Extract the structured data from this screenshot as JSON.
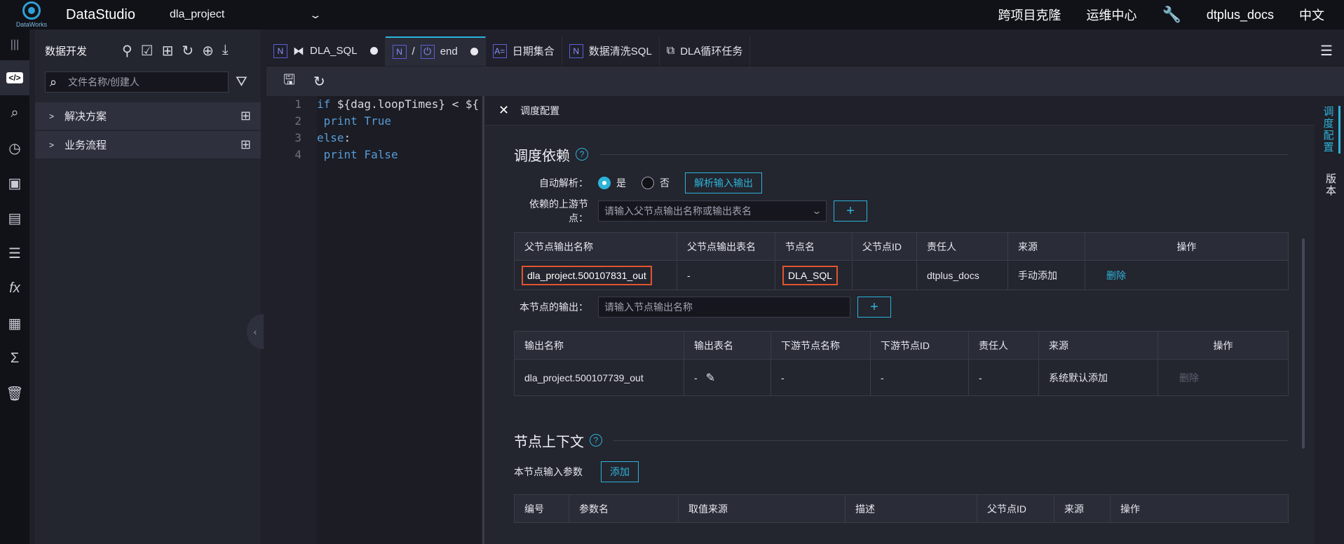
{
  "topbar": {
    "logo_text": "DataWorks",
    "app_title": "DataStudio",
    "project": "dla_project",
    "cross_clone": "跨项目克隆",
    "ops_center": "运维中心",
    "user": "dtplus_docs",
    "language": "中文"
  },
  "sidebar": {
    "title": "数据开发",
    "search_placeholder": "文件名称/创建人",
    "items": [
      {
        "label": "解决方案"
      },
      {
        "label": "业务流程"
      }
    ]
  },
  "tabs": [
    {
      "label": "DLA_SQL"
    },
    {
      "label": "end"
    },
    {
      "label": "日期集合"
    },
    {
      "label": "数据清洗SQL"
    },
    {
      "label": "DLA循环任务"
    }
  ],
  "tab_prefix": {
    "n": "N",
    "slash": "/",
    "a": "A="
  },
  "editor": {
    "line_numbers": [
      "1",
      "2",
      "3",
      "4"
    ],
    "lines": [
      {
        "kw": "if",
        "rest": " ${dag.loopTimes} < ${"
      },
      {
        "kw": " print",
        "rest": " True"
      },
      {
        "kw": "else",
        "rest": ":"
      },
      {
        "kw": " print",
        "rest": " False"
      }
    ]
  },
  "panel": {
    "title": "调度配置",
    "dependency": {
      "title": "调度依赖",
      "auto_parse_label": "自动解析：",
      "yes": "是",
      "no": "否",
      "parse_button": "解析输入输出",
      "upstream_label": "依赖的上游节点：",
      "upstream_placeholder": "请输入父节点输出名称或输出表名",
      "upstream_table": {
        "headers": [
          "父节点输出名称",
          "父节点输出表名",
          "节点名",
          "父节点ID",
          "责任人",
          "来源",
          "操作"
        ],
        "rows": [
          {
            "output_name": "dla_project.500107831_out",
            "output_table": "-",
            "node_name": "DLA_SQL",
            "node_id": "",
            "owner": "dtplus_docs",
            "source": "手动添加",
            "action": "删除"
          }
        ]
      },
      "output_label": "本节点的输出：",
      "output_placeholder": "请输入节点输出名称",
      "output_table": {
        "headers": [
          "输出名称",
          "输出表名",
          "下游节点名称",
          "下游节点ID",
          "责任人",
          "来源",
          "操作"
        ],
        "rows": [
          {
            "output_name": "dla_project.500107739_out",
            "output_table": "-",
            "downstream_name": "-",
            "downstream_id": "-",
            "owner": "-",
            "source": "系统默认添加",
            "action": "删除"
          }
        ]
      }
    },
    "context": {
      "title": "节点上下文",
      "input_params_label": "本节点输入参数",
      "add_button": "添加",
      "table_headers": [
        "编号",
        "参数名",
        "取值来源",
        "描述",
        "父节点ID",
        "来源",
        "操作"
      ]
    }
  },
  "side_tabs": [
    "调度配置",
    "版本"
  ]
}
